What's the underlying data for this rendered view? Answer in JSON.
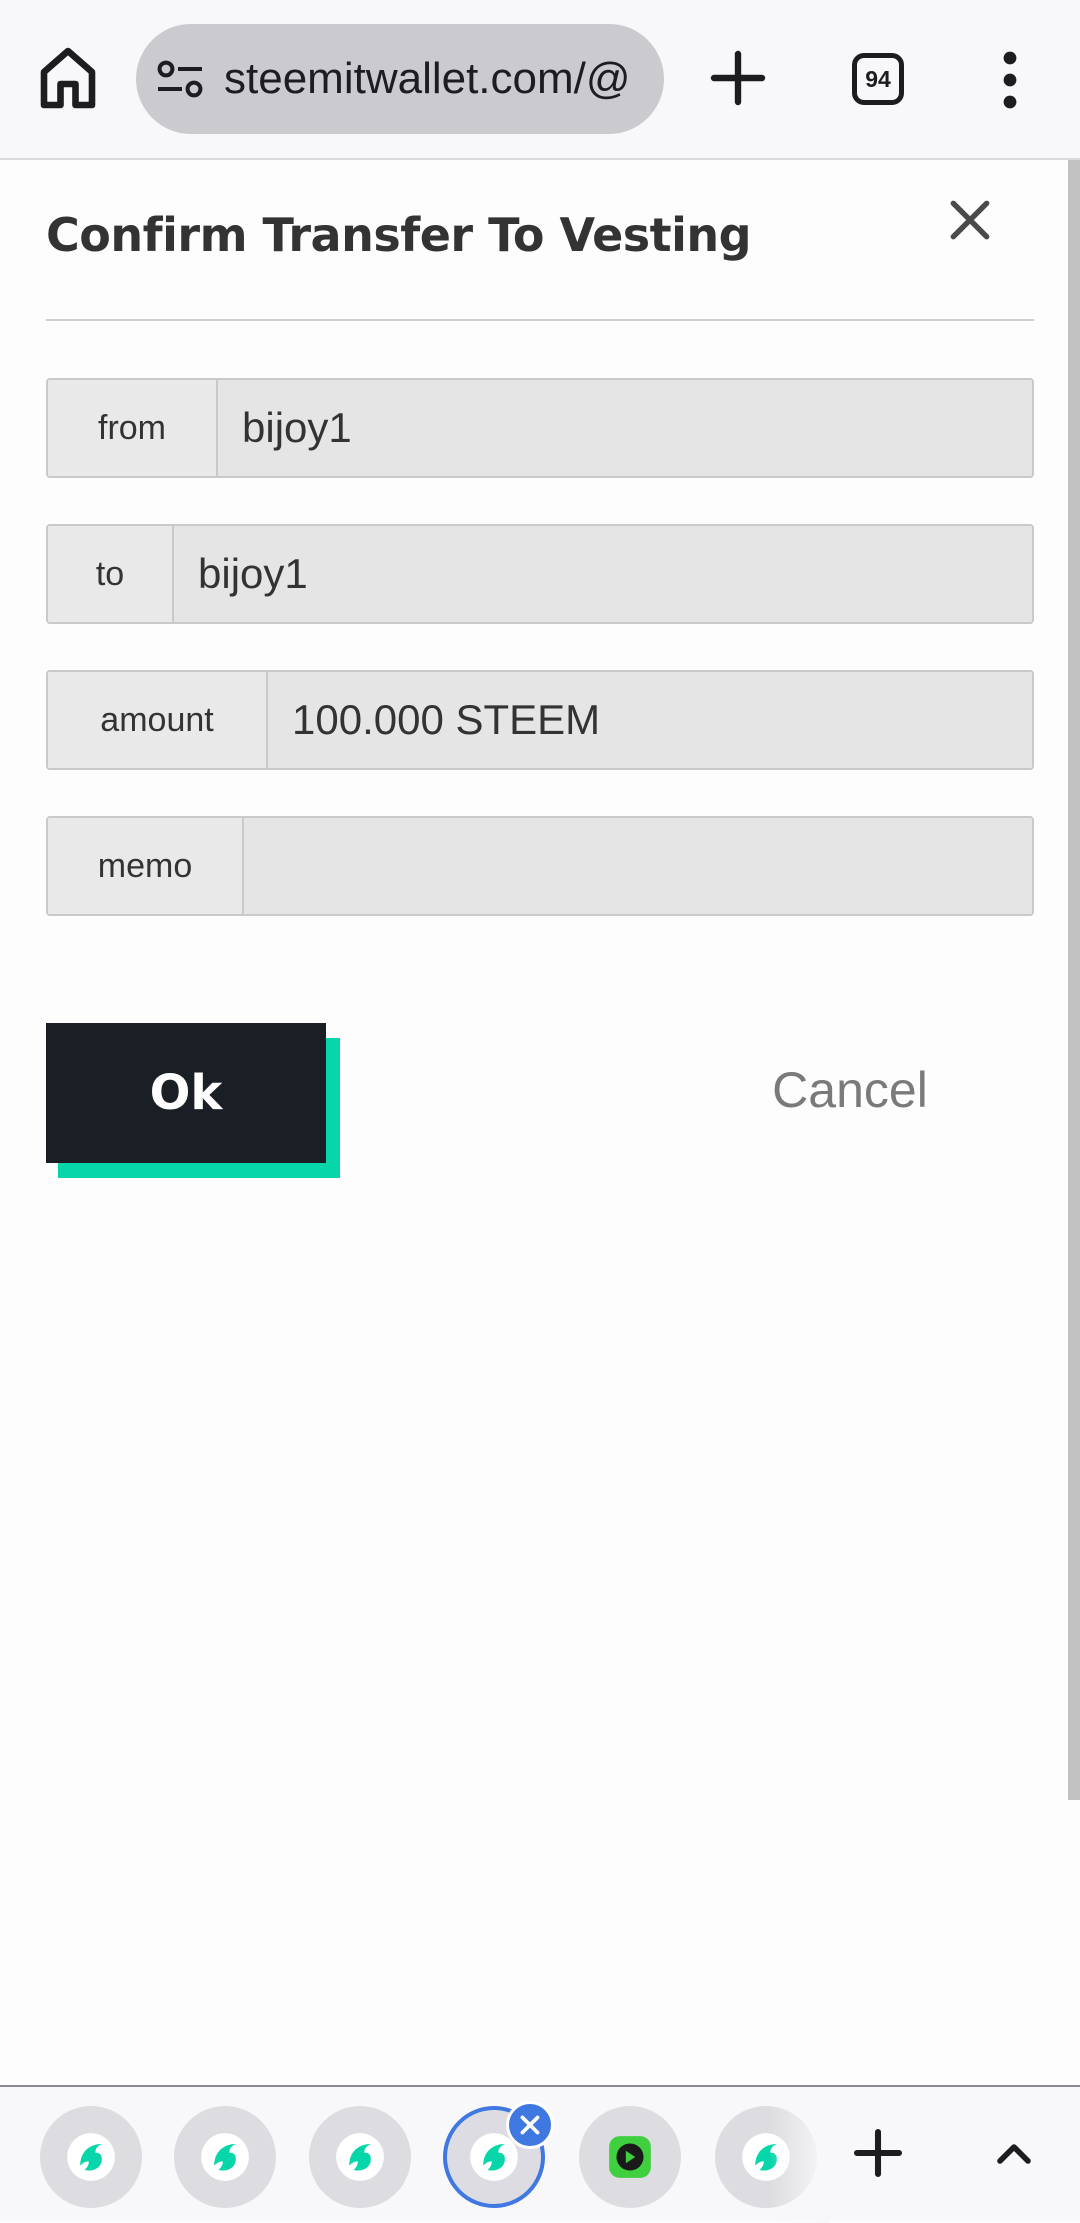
{
  "browser": {
    "url": "steemitwallet.com/@",
    "tab_count": "94"
  },
  "dialog": {
    "title": "Confirm Transfer To Vesting",
    "fields": [
      {
        "label": "from",
        "value": "bijoy1"
      },
      {
        "label": "to",
        "value": "bijoy1"
      },
      {
        "label": "amount",
        "value": "100.000 STEEM"
      },
      {
        "label": "memo",
        "value": ""
      }
    ],
    "ok_label": "Ok",
    "cancel_label": "Cancel"
  },
  "tab_strip": {
    "tabs": [
      {
        "icon": "steemit-icon",
        "active": false
      },
      {
        "icon": "steemit-icon",
        "active": false
      },
      {
        "icon": "steemit-icon",
        "active": false
      },
      {
        "icon": "steemit-icon",
        "active": true
      },
      {
        "icon": "video-app-icon",
        "active": false
      },
      {
        "icon": "steemit-icon",
        "active": false
      }
    ]
  },
  "colors": {
    "accent_teal": "#06d6a9",
    "ok_button": "#1a1f26",
    "active_tab": "#3f78e0"
  }
}
